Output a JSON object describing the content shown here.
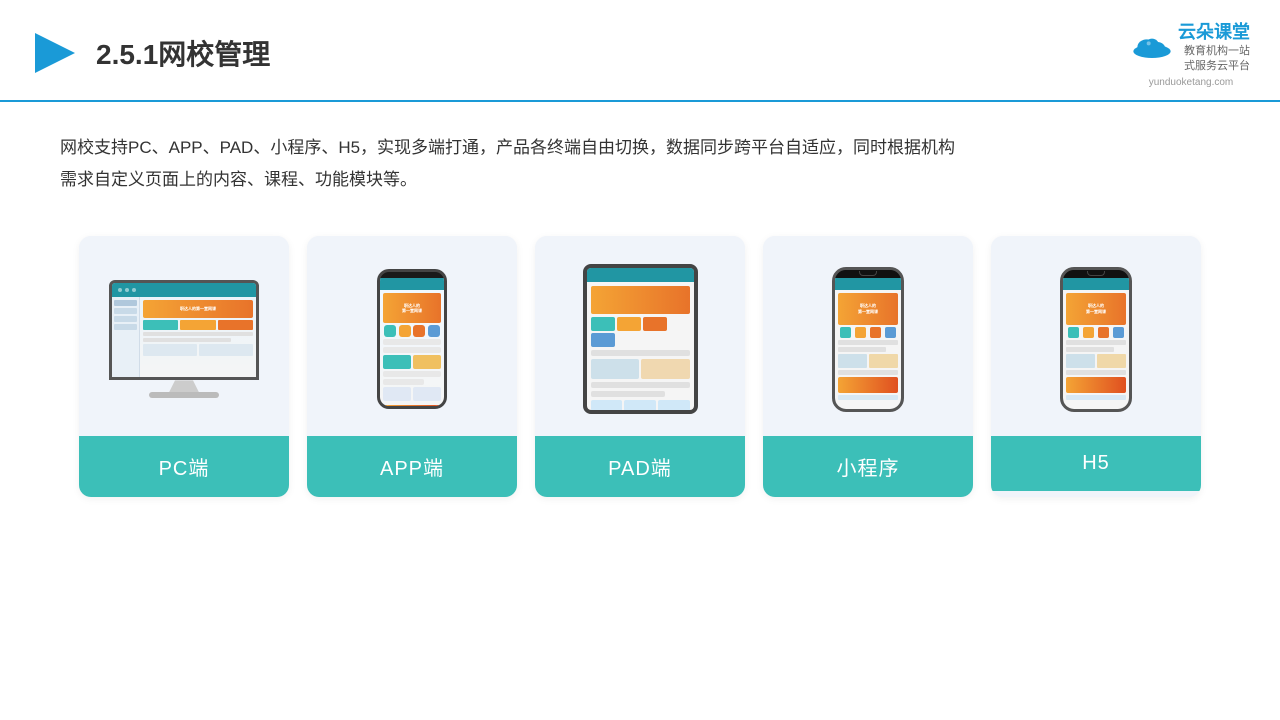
{
  "header": {
    "title": "2.5.1网校管理",
    "logo_name": "云朵课堂",
    "logo_url": "yunduoketang.com",
    "logo_slogan": "教育机构一站\n式服务云平台"
  },
  "description": "网校支持PC、APP、PAD、小程序、H5，实现多端打通，产品各终端自由切换，数据同步跨平台自适应，同时根据机构\n需求自定义页面上的内容、课程、功能模块等。",
  "cards": [
    {
      "id": "pc",
      "label": "PC端"
    },
    {
      "id": "app",
      "label": "APP端"
    },
    {
      "id": "pad",
      "label": "PAD端"
    },
    {
      "id": "miniprogram",
      "label": "小程序"
    },
    {
      "id": "h5",
      "label": "H5"
    }
  ]
}
